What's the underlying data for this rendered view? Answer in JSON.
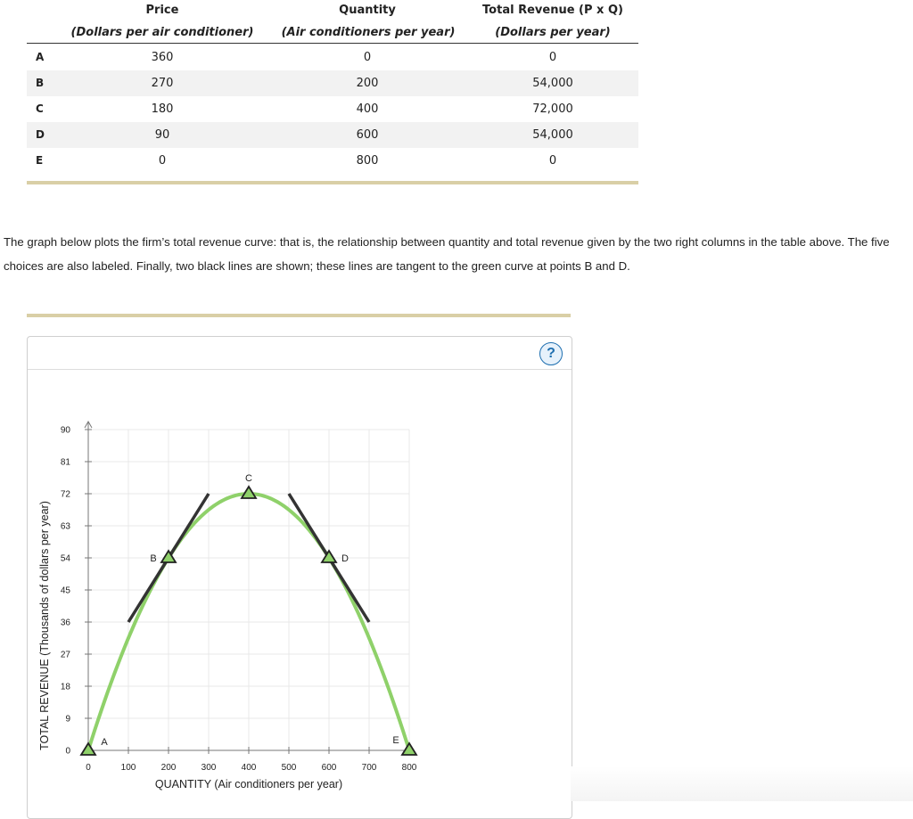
{
  "table": {
    "headers": [
      {
        "title": "Price",
        "subtitle": "(Dollars per air conditioner)"
      },
      {
        "title": "Quantity",
        "subtitle": "(Air conditioners per year)"
      },
      {
        "title": "Total Revenue (P x Q)",
        "subtitle": "(Dollars per year)"
      }
    ],
    "rows": [
      {
        "label": "A",
        "price": "360",
        "quantity": "0",
        "revenue": "0"
      },
      {
        "label": "B",
        "price": "270",
        "quantity": "200",
        "revenue": "54,000"
      },
      {
        "label": "C",
        "price": "180",
        "quantity": "400",
        "revenue": "72,000"
      },
      {
        "label": "D",
        "price": "90",
        "quantity": "600",
        "revenue": "54,000"
      },
      {
        "label": "E",
        "price": "0",
        "quantity": "800",
        "revenue": "0"
      }
    ]
  },
  "paragraph": "The graph below plots the firm’s total revenue curve: that is, the relationship between quantity and total revenue given by the two right columns in the table above. The five choices are also labeled. Finally, two black lines are shown; these lines are tangent to the green curve at points B and D.",
  "help_label": "?",
  "colors": {
    "curve": "#8fd16a",
    "tangent": "#333333",
    "marker_fill": "#8fd16a",
    "divider": "#d9cfa6",
    "help": "#1e6fb0"
  },
  "chart_data": {
    "type": "line",
    "xlabel": "QUANTITY (Air conditioners per year)",
    "ylabel": "TOTAL REVENUE (Thousands of dollars per year)",
    "xlim": [
      0,
      800
    ],
    "ylim": [
      0,
      90
    ],
    "x_ticks": [
      0,
      100,
      200,
      300,
      400,
      500,
      600,
      700,
      800
    ],
    "y_ticks": [
      0,
      9,
      18,
      27,
      36,
      45,
      54,
      63,
      72,
      81,
      90
    ],
    "grid": true,
    "curve": {
      "x": [
        0,
        100,
        200,
        300,
        400,
        500,
        600,
        700,
        800
      ],
      "y": [
        0,
        31.5,
        54,
        67.5,
        72,
        67.5,
        54,
        31.5,
        0
      ]
    },
    "points": [
      {
        "label": "A",
        "x": 0,
        "y": 0
      },
      {
        "label": "B",
        "x": 200,
        "y": 54
      },
      {
        "label": "C",
        "x": 400,
        "y": 72
      },
      {
        "label": "D",
        "x": 600,
        "y": 54
      },
      {
        "label": "E",
        "x": 800,
        "y": 0
      }
    ],
    "tangents": [
      {
        "at": "B",
        "x": [
          100,
          300
        ],
        "y": [
          36,
          72
        ]
      },
      {
        "at": "D",
        "x": [
          500,
          700
        ],
        "y": [
          72,
          36
        ]
      }
    ]
  }
}
